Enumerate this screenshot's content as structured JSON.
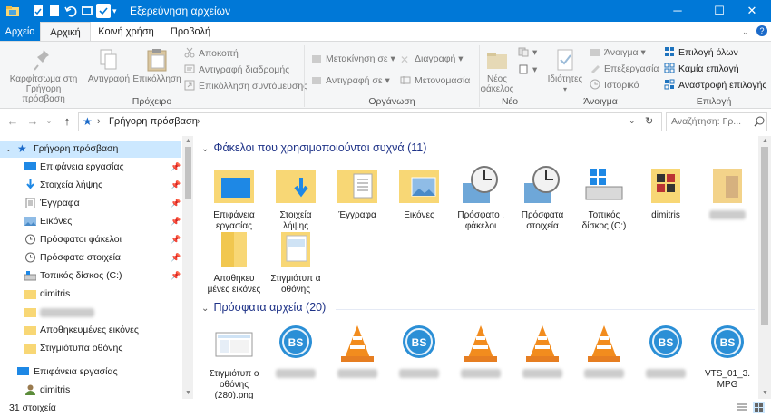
{
  "window": {
    "title": "Εξερεύνηση αρχείων"
  },
  "ribbon_tabs": {
    "file": "Αρχείο",
    "home": "Αρχική",
    "share": "Κοινή χρήση",
    "view": "Προβολή"
  },
  "ribbon": {
    "clipboard": {
      "label": "Πρόχειρο",
      "pin": "Καρφίτσωμα στη Γρήγορη πρόσβαση",
      "copy": "Αντιγραφή",
      "paste": "Επικόλληση",
      "cut": "Αποκοπή",
      "copy_path": "Αντιγραφή διαδρομής",
      "paste_shortcut": "Επικόλληση συντόμευσης"
    },
    "organize": {
      "label": "Οργάνωση",
      "move_to": "Μετακίνηση σε",
      "copy_to": "Αντιγραφή σε",
      "delete": "Διαγραφή",
      "rename": "Μετονομασία"
    },
    "new": {
      "label": "Νέο",
      "new_folder": "Νέος φάκελος"
    },
    "open": {
      "label": "Άνοιγμα",
      "properties": "Ιδιότητες",
      "open": "Άνοιγμα",
      "edit": "Επεξεργασία",
      "history": "Ιστορικό"
    },
    "select": {
      "label": "Επιλογή",
      "select_all": "Επιλογή όλων",
      "select_none": "Καμία επιλογή",
      "invert": "Αναστροφή επιλογής"
    }
  },
  "address": {
    "path": "Γρήγορη πρόσβαση",
    "search_placeholder": "Αναζήτηση: Γρ..."
  },
  "nav": {
    "quick_access": "Γρήγορη πρόσβαση",
    "items": [
      "Επιφάνεια εργασίας",
      "Στοιχεία λήψης",
      "Έγγραφα",
      "Εικόνες",
      "Πρόσφατοι φάκελοι",
      "Πρόσφατα στοιχεία",
      "Τοπικός δίσκος (C:)",
      "dimitris",
      "",
      "Αποθηκευμένες εικόνες",
      "Στιγμιότυπα οθόνης"
    ],
    "desktop": "Επιφάνεια εργασίας",
    "user": "dimitris"
  },
  "frequent": {
    "header": "Φάκελοι που χρησιμοποιούνται συχνά (11)",
    "tiles": [
      "Επιφάνεια εργασίας",
      "Στοιχεία λήψης",
      "Έγγραφα",
      "Εικόνες",
      "Πρόσφατο ι φάκελοι",
      "Πρόσφατα στοιχεία",
      "Τοπικός δίσκος (C:)",
      "dimitris",
      "",
      "Αποθηκευ μένες εικόνες",
      "Στιγμιότυπ α οθόνης"
    ]
  },
  "recent": {
    "header": "Πρόσφατα αρχεία (20)",
    "tiles": [
      "Στιγμιότυπ ο οθόνης (280).png",
      "",
      "",
      "",
      "",
      "",
      "",
      "",
      "VTS_01_3. MPG"
    ]
  },
  "status": {
    "count": "31 στοιχεία"
  },
  "colors": {
    "accent": "#0078d7",
    "selected": "#cce8ff",
    "header_text": "#1e3287"
  }
}
